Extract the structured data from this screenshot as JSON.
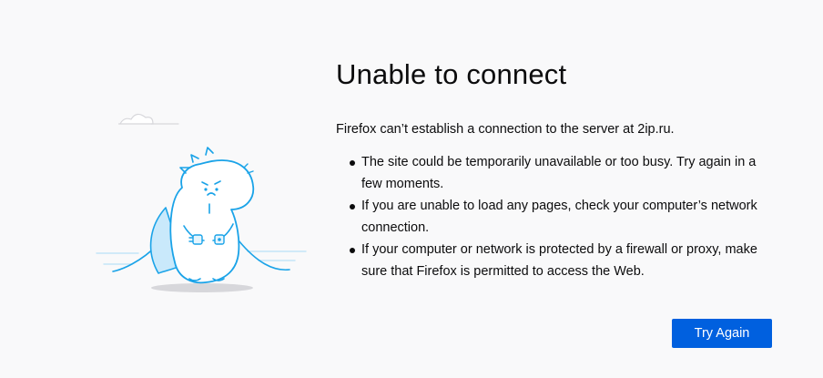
{
  "error": {
    "title": "Unable to connect",
    "description": "Firefox can’t establish a connection to the server at 2ip.ru.",
    "reasons": [
      "The site could be temporarily unavailable or too busy. Try again in a few moments.",
      "If you are unable to load any pages, check your computer’s network connection.",
      "If your computer or network is protected by a firewall or proxy, make sure that Firefox is permitted to access the Web."
    ],
    "try_again_label": "Try Again"
  },
  "illustration": {
    "icon": "unplugged-dinosaur-illustration"
  },
  "colors": {
    "background": "#f9f9fa",
    "accent": "#0060df",
    "illustration_stroke": "#1aa3e8",
    "illustration_fill": "#e6f5fd"
  }
}
